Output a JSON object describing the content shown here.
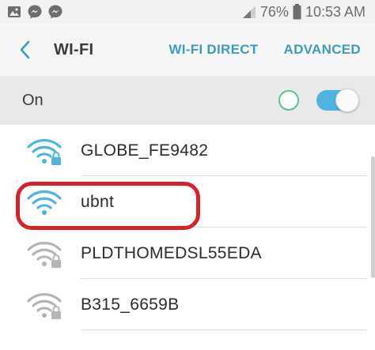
{
  "status_bar": {
    "battery_percent": "76%",
    "time": "10:53 AM",
    "notification_icons": [
      "photo-icon",
      "messenger-icon",
      "messenger-icon"
    ],
    "system_icons": [
      "signal-icon",
      "battery-icon"
    ]
  },
  "action_bar": {
    "title": "WI-FI",
    "wifi_direct_label": "WI-FI DIRECT",
    "advanced_label": "ADVANCED"
  },
  "wifi_switch": {
    "label": "On",
    "state": "on"
  },
  "networks": [
    {
      "ssid": "GLOBE_FE9482",
      "secured": true,
      "signal_color": "#4fb4e0"
    },
    {
      "ssid": "ubnt",
      "secured": false,
      "signal_color": "#4fb4e0",
      "highlighted": true
    },
    {
      "ssid": "PLDTHOMEDSL55EDA",
      "secured": true,
      "signal_color": "#b5b5b5"
    },
    {
      "ssid": "B315_6659B",
      "secured": true,
      "signal_color": "#b5b5b5"
    }
  ],
  "colors": {
    "accent": "#3e9bbf",
    "toggle_on": "#4fb4e0",
    "highlight": "#d82227",
    "ring": "#5cc18a"
  }
}
